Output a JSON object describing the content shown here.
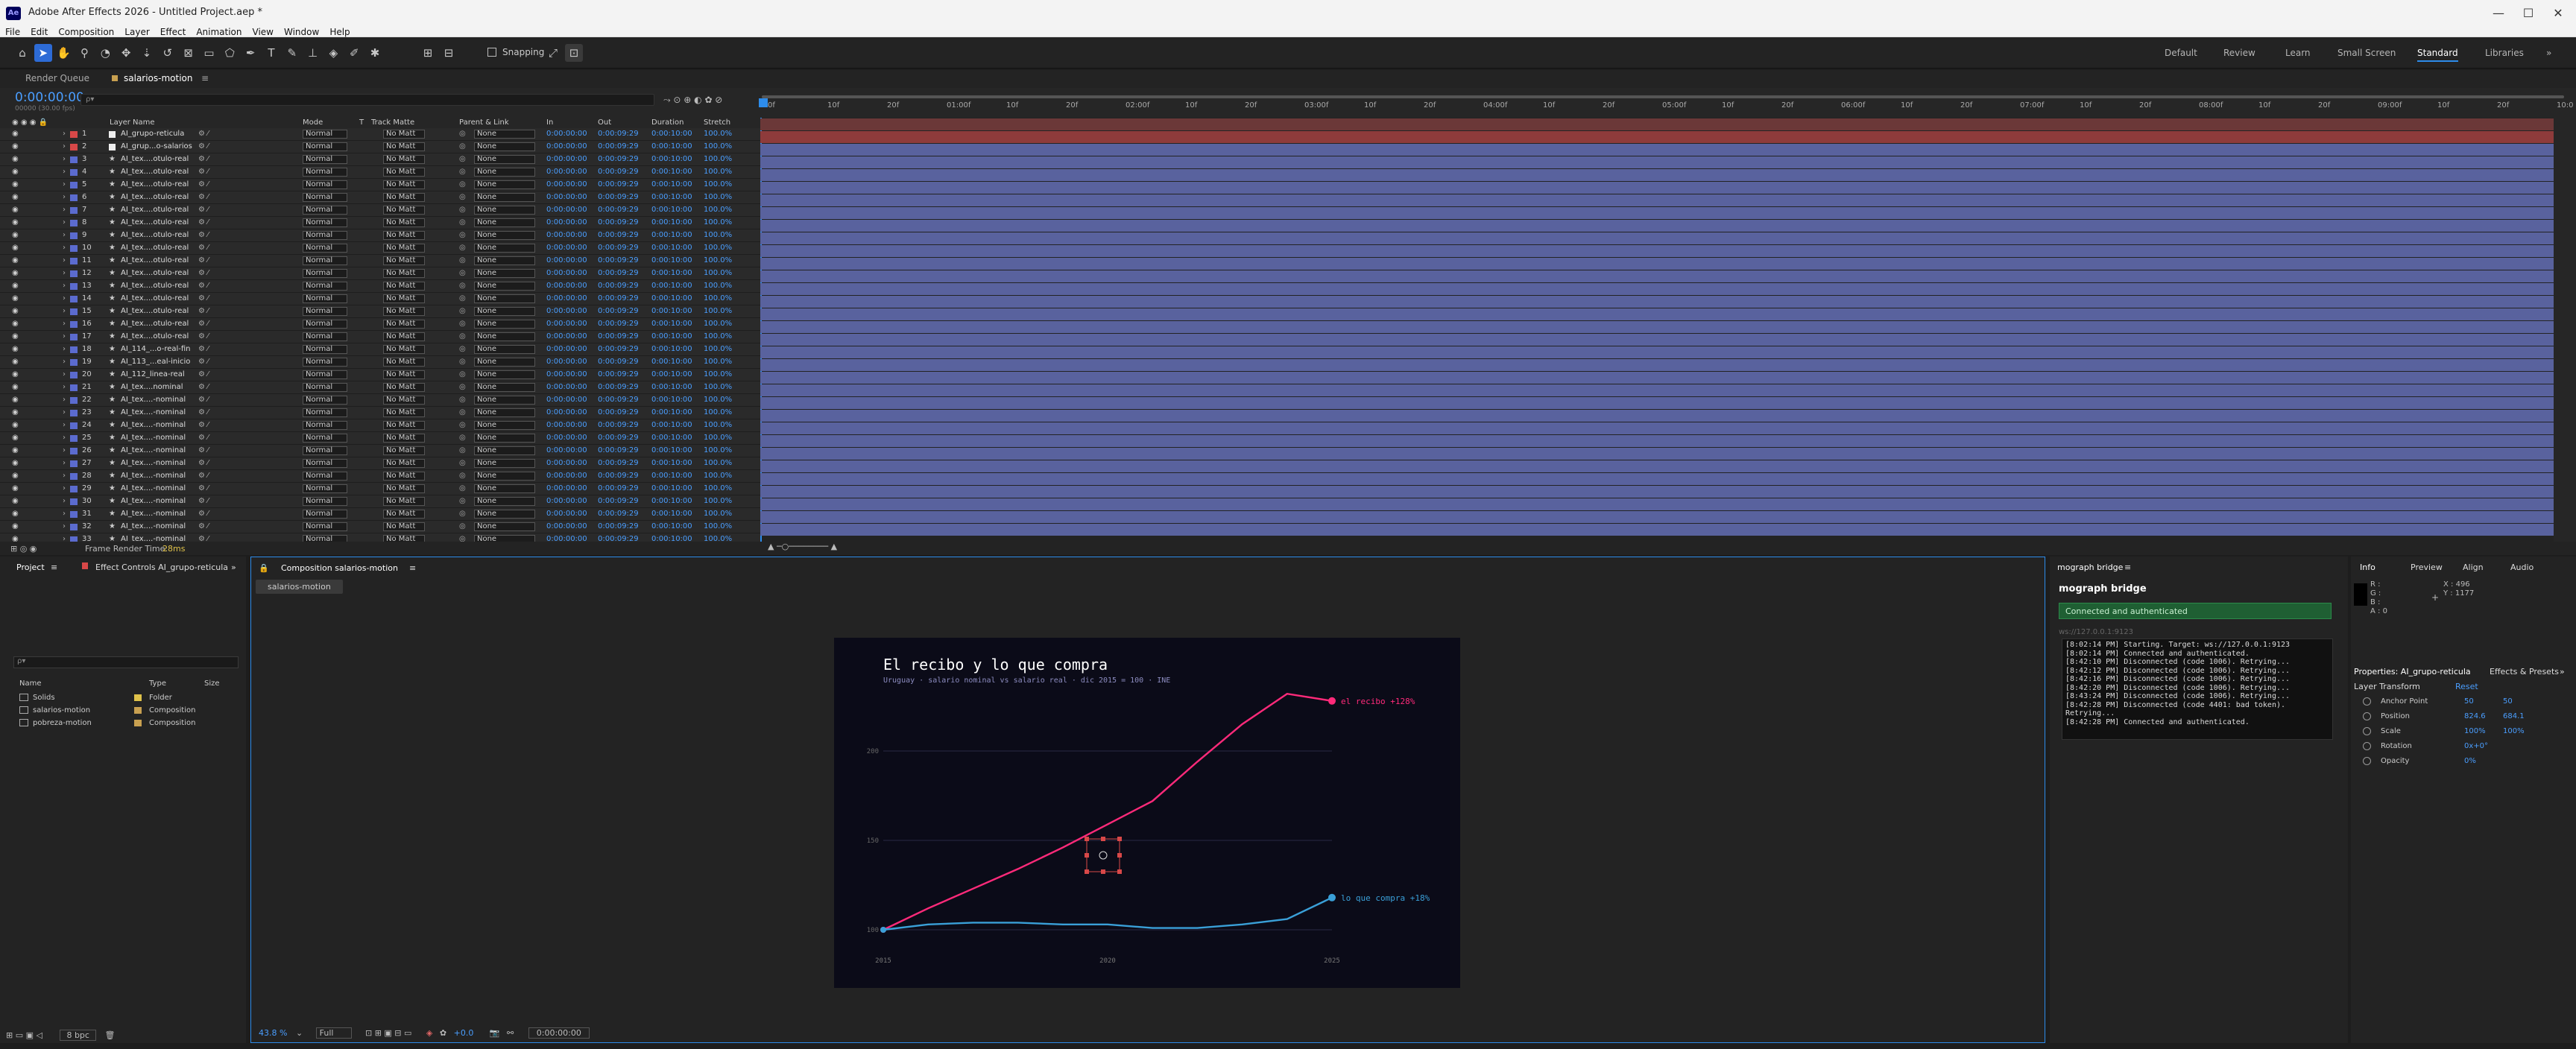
{
  "window": {
    "title": "Adobe After Effects 2026 - Untitled Project.aep *",
    "logo": "Ae",
    "controls": [
      "—",
      "☐",
      "✕"
    ]
  },
  "menu": [
    "File",
    "Edit",
    "Composition",
    "Layer",
    "Effect",
    "Animation",
    "View",
    "Window",
    "Help"
  ],
  "toolbar": {
    "snapping": "Snapping",
    "workspaces": [
      "Default",
      "Review",
      "Learn",
      "Small Screen",
      "Standard",
      "Libraries"
    ],
    "active_workspace": "Standard"
  },
  "timeline": {
    "tabs": [
      "Render Queue",
      "salarios-motion"
    ],
    "timecode": "0:00:00:00",
    "timecode_sub": "00000 (30.00 fps)",
    "search_placeholder": "ρ▾",
    "columns": {
      "layer_name": "Layer Name",
      "mode": "Mode",
      "t": "T",
      "track_matte": "Track Matte",
      "parent": "Parent & Link",
      "in": "In",
      "out": "Out",
      "duration": "Duration",
      "stretch": "Stretch"
    },
    "ruler": [
      "0f",
      "10f",
      "20f",
      "01:00f",
      "10f",
      "20f",
      "02:00f",
      "10f",
      "20f",
      "03:00f",
      "10f",
      "20f",
      "04:00f",
      "10f",
      "20f",
      "05:00f",
      "10f",
      "20f",
      "06:00f",
      "10f",
      "20f",
      "07:00f",
      "10f",
      "20f",
      "08:00f",
      "10f",
      "20f",
      "09:00f",
      "10f",
      "20f",
      "10:0"
    ],
    "layers": [
      {
        "n": "1",
        "name": "AI_grupo-reticula",
        "label": "#d84848",
        "icon": "solid",
        "bar": "#6b3838"
      },
      {
        "n": "2",
        "name": "AI_grup...o-salarios",
        "label": "#d84848",
        "icon": "solid",
        "bar": "#8e3b3b"
      },
      {
        "n": "3",
        "name": "AI_tex....otulo-real",
        "label": "#5b6bcf",
        "icon": "star",
        "bar": "#59629e"
      },
      {
        "n": "4",
        "name": "AI_tex....otulo-real",
        "label": "#5b6bcf",
        "icon": "star",
        "bar": "#59629e"
      },
      {
        "n": "5",
        "name": "AI_tex....otulo-real",
        "label": "#5b6bcf",
        "icon": "star",
        "bar": "#59629e"
      },
      {
        "n": "6",
        "name": "AI_tex....otulo-real",
        "label": "#5b6bcf",
        "icon": "star",
        "bar": "#59629e"
      },
      {
        "n": "7",
        "name": "AI_tex....otulo-real",
        "label": "#5b6bcf",
        "icon": "star",
        "bar": "#59629e"
      },
      {
        "n": "8",
        "name": "AI_tex....otulo-real",
        "label": "#5b6bcf",
        "icon": "star",
        "bar": "#59629e"
      },
      {
        "n": "9",
        "name": "AI_tex....otulo-real",
        "label": "#5b6bcf",
        "icon": "star",
        "bar": "#59629e"
      },
      {
        "n": "10",
        "name": "AI_tex....otulo-real",
        "label": "#5b6bcf",
        "icon": "star",
        "bar": "#59629e"
      },
      {
        "n": "11",
        "name": "AI_tex....otulo-real",
        "label": "#5b6bcf",
        "icon": "star",
        "bar": "#59629e"
      },
      {
        "n": "12",
        "name": "AI_tex....otulo-real",
        "label": "#5b6bcf",
        "icon": "star",
        "bar": "#59629e"
      },
      {
        "n": "13",
        "name": "AI_tex....otulo-real",
        "label": "#5b6bcf",
        "icon": "star",
        "bar": "#59629e"
      },
      {
        "n": "14",
        "name": "AI_tex....otulo-real",
        "label": "#5b6bcf",
        "icon": "star",
        "bar": "#59629e"
      },
      {
        "n": "15",
        "name": "AI_tex....otulo-real",
        "label": "#5b6bcf",
        "icon": "star",
        "bar": "#59629e"
      },
      {
        "n": "16",
        "name": "AI_tex....otulo-real",
        "label": "#5b6bcf",
        "icon": "star",
        "bar": "#59629e"
      },
      {
        "n": "17",
        "name": "AI_tex....otulo-real",
        "label": "#5b6bcf",
        "icon": "star",
        "bar": "#59629e"
      },
      {
        "n": "18",
        "name": "AI_114_...o-real-fin",
        "label": "#5b6bcf",
        "icon": "star",
        "bar": "#59629e"
      },
      {
        "n": "19",
        "name": "AI_113_...eal-inicio",
        "label": "#5b6bcf",
        "icon": "star",
        "bar": "#59629e"
      },
      {
        "n": "20",
        "name": "AI_112_linea-real",
        "label": "#5b6bcf",
        "icon": "star",
        "bar": "#59629e"
      },
      {
        "n": "21",
        "name": "AI_tex....nominal",
        "label": "#5b6bcf",
        "icon": "star",
        "bar": "#59629e"
      },
      {
        "n": "22",
        "name": "AI_tex....-nominal",
        "label": "#5b6bcf",
        "icon": "star",
        "bar": "#59629e"
      },
      {
        "n": "23",
        "name": "AI_tex....-nominal",
        "label": "#5b6bcf",
        "icon": "star",
        "bar": "#59629e"
      },
      {
        "n": "24",
        "name": "AI_tex....-nominal",
        "label": "#5b6bcf",
        "icon": "star",
        "bar": "#59629e"
      },
      {
        "n": "25",
        "name": "AI_tex....-nominal",
        "label": "#5b6bcf",
        "icon": "star",
        "bar": "#59629e"
      },
      {
        "n": "26",
        "name": "AI_tex....-nominal",
        "label": "#5b6bcf",
        "icon": "star",
        "bar": "#59629e"
      },
      {
        "n": "27",
        "name": "AI_tex....-nominal",
        "label": "#5b6bcf",
        "icon": "star",
        "bar": "#59629e"
      },
      {
        "n": "28",
        "name": "AI_tex....-nominal",
        "label": "#5b6bcf",
        "icon": "star",
        "bar": "#59629e"
      },
      {
        "n": "29",
        "name": "AI_tex....-nominal",
        "label": "#5b6bcf",
        "icon": "star",
        "bar": "#59629e"
      },
      {
        "n": "30",
        "name": "AI_tex....-nominal",
        "label": "#5b6bcf",
        "icon": "star",
        "bar": "#59629e"
      },
      {
        "n": "31",
        "name": "AI_tex....-nominal",
        "label": "#5b6bcf",
        "icon": "star",
        "bar": "#59629e"
      },
      {
        "n": "32",
        "name": "AI_tex....-nominal",
        "label": "#5b6bcf",
        "icon": "star",
        "bar": "#59629e"
      },
      {
        "n": "33",
        "name": "AI_tex....-nominal",
        "label": "#5b6bcf",
        "icon": "star",
        "bar": "#59629e"
      }
    ],
    "row_values": {
      "mode": "Normal",
      "matte": "No Matt",
      "parent": "None",
      "in": "0:00:00:00",
      "out": "0:00:09:29",
      "duration": "0:00:10:00",
      "stretch": "100.0%"
    },
    "footer": {
      "label": "Frame Render Time:",
      "value": "28ms"
    }
  },
  "project": {
    "tabs": [
      "Project",
      "Effect Controls AI_grupo-reticula"
    ],
    "search_placeholder": "ρ▾",
    "columns": [
      "Name",
      "Type",
      "Size"
    ],
    "items": [
      {
        "name": "Solids",
        "type": "Folder",
        "icon": "folder-icon"
      },
      {
        "name": "salarios-motion",
        "type": "Composition",
        "icon": "composition-icon"
      },
      {
        "name": "pobreza-motion",
        "type": "Composition",
        "icon": "composition-icon"
      }
    ],
    "bpc": "8 bpc"
  },
  "comp": {
    "tab": "Composition salarios-motion",
    "subtab": "salarios-motion",
    "zoom": "43.8 %",
    "resolution": "Full",
    "exposure": "+0.0",
    "time": "0:00:00:00"
  },
  "chart_data": {
    "type": "line",
    "title": "El recibo y lo que compra",
    "subtitle": "Uruguay · salario nominal vs salario real · dic 2015 = 100 · INE",
    "x": [
      2015,
      2016,
      2017,
      2018,
      2019,
      2020,
      2021,
      2022,
      2023,
      2024,
      2025
    ],
    "xticks": [
      "2015",
      "2020",
      "2025"
    ],
    "yticks": [
      "100",
      "150",
      "200"
    ],
    "ylim": [
      100,
      230
    ],
    "series": [
      {
        "name": "el recibo +128%",
        "color": "#ff2a7a",
        "values": [
          100,
          112,
          123,
          134,
          146,
          159,
          172,
          194,
          215,
          232,
          228
        ]
      },
      {
        "name": "lo que compra +18%",
        "color": "#3aa0d8",
        "values": [
          100,
          103,
          104,
          104,
          103,
          103,
          101,
          101,
          103,
          106,
          118
        ]
      }
    ]
  },
  "mograph": {
    "tab": "mograph bridge",
    "title": "mograph bridge",
    "status": "Connected and authenticated",
    "url": "ws://127.0.0.1:9123",
    "log": [
      "[8:02:14 PM] Starting. Target: ws://127.0.0.1:9123",
      "[8:02:14 PM] Connected and authenticated.",
      "[8:42:10 PM] Disconnected (code 1006). Retrying...",
      "[8:42:12 PM] Disconnected (code 1006). Retrying...",
      "[8:42:16 PM] Disconnected (code 1006). Retrying...",
      "[8:42:20 PM] Disconnected (code 1006). Retrying...",
      "[8:43:24 PM] Disconnected (code 1006). Retrying...",
      "[8:42:28 PM] Disconnected (code 4401: bad token).",
      "Retrying...",
      "[8:42:28 PM] Connected and authenticated."
    ]
  },
  "info": {
    "tabs": [
      "Info",
      "Preview",
      "Align",
      "Audio"
    ],
    "r": "R :",
    "g": "G :",
    "b": "B :",
    "a": "A : 0",
    "x": "X : 496",
    "y": "Y : 1177"
  },
  "properties": {
    "tabs": [
      "Properties: AI_grupo-reticula",
      "Effects & Presets"
    ],
    "section": "Layer Transform",
    "reset": "Reset",
    "rows": [
      {
        "label": "Anchor Point",
        "v1": "50",
        "v2": "50"
      },
      {
        "label": "Position",
        "v1": "824.6",
        "v2": "684.1"
      },
      {
        "label": "Scale",
        "v1": "100%",
        "v2": "100%"
      },
      {
        "label": "Rotation",
        "v1": "0x+0°",
        "v2": ""
      },
      {
        "label": "Opacity",
        "v1": "0%",
        "v2": ""
      }
    ]
  }
}
